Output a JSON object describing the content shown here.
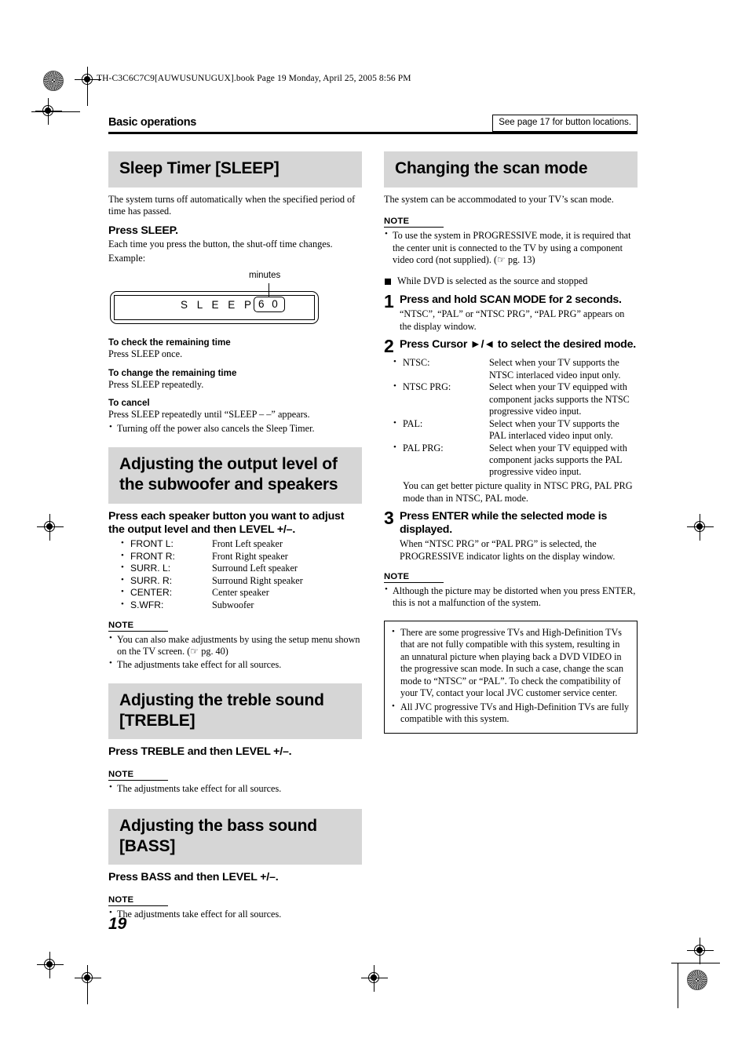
{
  "file_header": "TH-C3C6C7C9[AUWUSUNUGUX].book  Page 19  Monday, April 25, 2005  8:56 PM",
  "running_head": "Basic operations",
  "see_page_note": "See page 17 for button locations.",
  "folio": "19",
  "colors": {
    "section_bar": "#d6d6d6",
    "rule": "#000000",
    "page_bg": "#ffffff"
  },
  "left_column": {
    "sleep_timer": {
      "title": "Sleep Timer [SLEEP]",
      "intro": "The system turns off automatically when the specified period of time has passed.",
      "instruction": "Press SLEEP.",
      "instruction_desc": "Each time you press the button, the shut-off time changes.",
      "example_label": "Example:",
      "figure": {
        "callout": "minutes",
        "display_text": "S L E E P",
        "display_value": "6 0"
      },
      "subsections": [
        {
          "heading": "To check the remaining time",
          "text": "Press SLEEP once."
        },
        {
          "heading": "To change the remaining time",
          "text": "Press SLEEP repeatedly."
        },
        {
          "heading": "To cancel",
          "text": "Press SLEEP repeatedly until “SLEEP – –” appears.",
          "bullet": "Turning off the power also cancels the Sleep Timer."
        }
      ]
    },
    "output_level": {
      "title": "Adjusting the output level of the subwoofer and speakers",
      "instruction": "Press each speaker button you want to adjust the output level and then LEVEL +/–.",
      "speakers": [
        {
          "button": "FRONT L:",
          "desc": "Front Left speaker"
        },
        {
          "button": "FRONT R:",
          "desc": "Front Right speaker"
        },
        {
          "button": "SURR. L:",
          "desc": "Surround Left speaker"
        },
        {
          "button": "SURR. R:",
          "desc": "Surround Right speaker"
        },
        {
          "button": "CENTER:",
          "desc": "Center speaker"
        },
        {
          "button": "S.WFR:",
          "desc": "Subwoofer"
        }
      ],
      "note_label": "NOTE",
      "notes": [
        "You can also make adjustments by using the setup menu shown on the TV screen. (☞ pg. 40)",
        "The adjustments take effect for all sources."
      ]
    },
    "treble": {
      "title": "Adjusting the treble sound [TREBLE]",
      "instruction": "Press TREBLE and then LEVEL +/–.",
      "note_label": "NOTE",
      "notes": [
        "The adjustments take effect for all sources."
      ]
    },
    "bass": {
      "title": "Adjusting the bass sound [BASS]",
      "instruction": "Press BASS and then LEVEL +/–.",
      "note_label": "NOTE",
      "notes": [
        "The adjustments take effect for all sources."
      ]
    }
  },
  "right_column": {
    "scan_mode": {
      "title": "Changing the scan mode",
      "intro": "The system can be accommodated to your TV’s scan mode.",
      "note_label_1": "NOTE",
      "notes_1": [
        "To use the system in PROGRESSIVE mode, it is required that the center unit is connected to the TV by using a component video cord (not supplied). (☞ pg. 13)"
      ],
      "condition_heading": "While DVD is selected as the source and stopped",
      "steps": [
        {
          "num": "1",
          "title": "Press and hold SCAN MODE for 2 seconds.",
          "desc": "“NTSC”, “PAL” or “NTSC PRG”, “PAL PRG” appears on the display window."
        },
        {
          "num": "2",
          "title": "Press Cursor ►/◄ to select the desired mode.",
          "desc": ""
        },
        {
          "num": "3",
          "title": "Press ENTER while the selected mode is displayed.",
          "desc": "When “NTSC PRG” or “PAL PRG” is selected, the PROGRESSIVE indicator lights on the display window."
        }
      ],
      "modes": [
        {
          "name": "NTSC:",
          "desc": "Select when your TV supports the NTSC interlaced video input only."
        },
        {
          "name": "NTSC PRG:",
          "desc": "Select when your TV equipped with component jacks supports the NTSC progressive video input."
        },
        {
          "name": "PAL:",
          "desc": "Select when your TV supports the PAL interlaced video input only."
        },
        {
          "name": "PAL PRG:",
          "desc": "Select when your TV equipped with component jacks supports the PAL progressive video input."
        }
      ],
      "modes_footnote": "You can get better picture quality in NTSC PRG, PAL PRG mode than in NTSC, PAL mode.",
      "note_label_2": "NOTE",
      "notes_2": [
        "Although the picture may be distorted when you press ENTER, this is not a malfunction of the system."
      ],
      "caution_bullets": [
        "There are some progressive TVs and High-Definition TVs that are not fully compatible with this system, resulting in an unnatural picture when playing back a DVD VIDEO in the progressive scan mode. In such a case, change the scan mode to “NTSC” or “PAL”. To check the compatibility of your TV, contact your local JVC customer service center.",
        "All JVC progressive TVs and High-Definition TVs are fully compatible with this system."
      ]
    }
  }
}
